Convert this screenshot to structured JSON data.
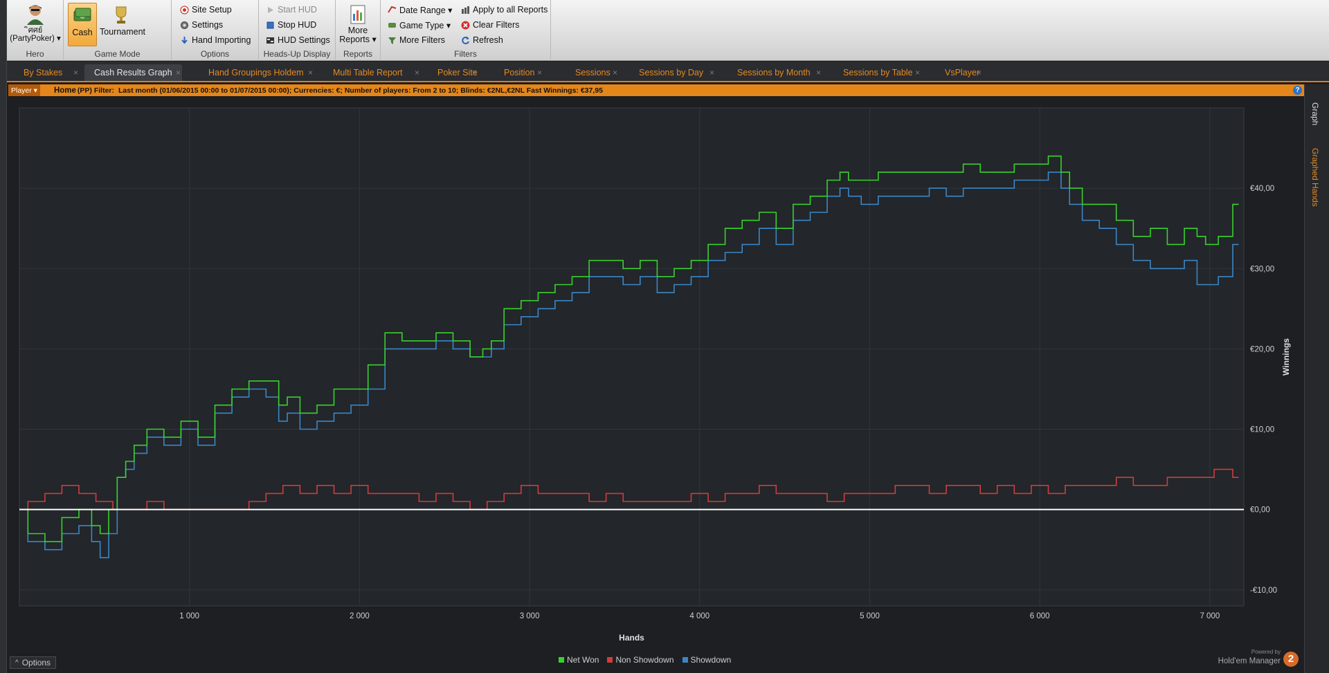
{
  "ribbon": {
    "hero": {
      "name_line1": "ิศศย์",
      "name_line2": "(PartyPoker) ▾",
      "group_label": "Hero"
    },
    "game_mode": {
      "cash_label": "Cash",
      "tournament_label": "Tournament",
      "group_label": "Game Mode"
    },
    "options": {
      "site_setup": "Site Setup",
      "settings": "Settings",
      "hand_importing": "Hand Importing",
      "group_label": "Options"
    },
    "hud": {
      "start_hud": "Start HUD",
      "stop_hud": "Stop HUD",
      "hud_settings": "HUD Settings",
      "group_label": "Heads-Up Display"
    },
    "reports": {
      "more_line1": "More",
      "more_line2": "Reports ▾",
      "group_label": "Reports"
    },
    "filters": {
      "date_range": "Date Range ▾",
      "game_type": "Game Type ▾",
      "more_filters": "More Filters",
      "apply_all": "Apply to all Reports",
      "clear_filters": "Clear Filters",
      "refresh": "Refresh",
      "group_label": "Filters"
    }
  },
  "tabs": [
    {
      "label": "By Stakes"
    },
    {
      "label": "Cash Results Graph"
    },
    {
      "label": "Hand Groupings Holdem"
    },
    {
      "label": "Multi Table Report"
    },
    {
      "label": "Poker Site"
    },
    {
      "label": "Position"
    },
    {
      "label": "Sessions"
    },
    {
      "label": "Sessions by Day"
    },
    {
      "label": "Sessions by Month"
    },
    {
      "label": "Sessions by Table"
    },
    {
      "label": "VsPlayer"
    }
  ],
  "tab_close": "×",
  "filterbar": {
    "player": "Player ▾",
    "home": "Home",
    "prefix": "(PP)  Filter:",
    "text": "Last month (01/06/2015 00:00 to 01/07/2015 00:00); Currencies: €; Number of players: From 2 to 10; Blinds: €2NL,€2NL Fast  Winnings: €37,95",
    "help": "?"
  },
  "sidepanel": {
    "graph": "Graph",
    "graphed_hands": "Graphed Hands"
  },
  "chart_data": {
    "type": "line",
    "xlabel": "Hands",
    "ylabel": "Winnings",
    "xlim": [
      0,
      7200
    ],
    "ylim": [
      -12,
      50
    ],
    "x_ticks": [
      1000,
      2000,
      3000,
      4000,
      5000,
      6000,
      7000
    ],
    "x_tick_labels": [
      "1 000",
      "2 000",
      "3 000",
      "4 000",
      "5 000",
      "6 000",
      "7 000"
    ],
    "y_ticks": [
      -10,
      0,
      10,
      20,
      30,
      40
    ],
    "y_tick_labels": [
      "-€10,00",
      "€0,00",
      "€10,00",
      "€20,00",
      "€30,00",
      "€40,00"
    ],
    "grid": true,
    "legend_position": "bottom",
    "series": [
      {
        "name": "Net Won",
        "color": "#39d22d",
        "x": [
          0,
          100,
          200,
          300,
          400,
          450,
          500,
          550,
          600,
          650,
          700,
          800,
          900,
          1000,
          1100,
          1200,
          1300,
          1400,
          1500,
          1550,
          1600,
          1700,
          1800,
          1900,
          2000,
          2100,
          2200,
          2300,
          2400,
          2500,
          2600,
          2700,
          2750,
          2800,
          2900,
          3000,
          3100,
          3200,
          3300,
          3400,
          3500,
          3600,
          3700,
          3800,
          3900,
          4000,
          4100,
          4200,
          4300,
          4400,
          4500,
          4600,
          4700,
          4800,
          4850,
          4900,
          5000,
          5100,
          5200,
          5300,
          5400,
          5500,
          5600,
          5700,
          5800,
          5900,
          6000,
          6100,
          6150,
          6200,
          6300,
          6400,
          6500,
          6600,
          6700,
          6800,
          6900,
          6950,
          7000,
          7100,
          7170
        ],
        "y": [
          0,
          -3,
          -4,
          -1,
          0,
          -2,
          -3,
          0,
          4,
          6,
          8,
          10,
          9,
          11,
          9,
          13,
          15,
          16,
          16,
          13,
          14,
          12,
          13,
          15,
          15,
          18,
          22,
          21,
          21,
          22,
          21,
          19,
          20,
          21,
          25,
          26,
          27,
          28,
          29,
          31,
          31,
          30,
          31,
          29,
          30,
          31,
          33,
          35,
          36,
          37,
          35,
          38,
          39,
          41,
          42,
          41,
          41,
          42,
          42,
          42,
          42,
          42,
          43,
          42,
          42,
          43,
          43,
          44,
          42,
          40,
          38,
          38,
          36,
          34,
          35,
          33,
          35,
          34,
          33,
          34,
          38
        ]
      },
      {
        "name": "Non Showdown",
        "color": "#d23c3c",
        "x": [
          0,
          100,
          200,
          300,
          400,
          500,
          600,
          700,
          800,
          900,
          1000,
          1100,
          1200,
          1300,
          1400,
          1500,
          1600,
          1700,
          1800,
          1900,
          2000,
          2100,
          2200,
          2300,
          2400,
          2500,
          2600,
          2700,
          2800,
          2900,
          3000,
          3100,
          3200,
          3300,
          3400,
          3500,
          3600,
          3700,
          3800,
          3900,
          4000,
          4100,
          4200,
          4300,
          4400,
          4500,
          4600,
          4700,
          4800,
          4900,
          5000,
          5100,
          5200,
          5300,
          5400,
          5500,
          5600,
          5700,
          5800,
          5900,
          6000,
          6100,
          6200,
          6300,
          6400,
          6500,
          6600,
          6700,
          6800,
          6900,
          7000,
          7050,
          7100,
          7170
        ],
        "y": [
          0,
          1,
          2,
          3,
          2,
          1,
          0,
          0,
          1,
          0,
          0,
          0,
          0,
          0,
          1,
          2,
          3,
          2,
          3,
          2,
          3,
          2,
          2,
          2,
          1,
          2,
          1,
          0,
          1,
          2,
          3,
          2,
          2,
          2,
          1,
          2,
          1,
          1,
          1,
          1,
          2,
          1,
          2,
          2,
          3,
          2,
          2,
          2,
          1,
          2,
          2,
          2,
          3,
          3,
          2,
          3,
          3,
          2,
          3,
          2,
          3,
          2,
          3,
          3,
          3,
          4,
          3,
          3,
          4,
          4,
          4,
          5,
          5,
          4
        ]
      },
      {
        "name": "Showdown",
        "color": "#3a87c8",
        "x": [
          0,
          100,
          200,
          300,
          400,
          450,
          500,
          550,
          600,
          650,
          700,
          800,
          900,
          1000,
          1100,
          1200,
          1300,
          1400,
          1500,
          1550,
          1600,
          1700,
          1800,
          1900,
          2000,
          2100,
          2200,
          2300,
          2400,
          2500,
          2600,
          2700,
          2750,
          2800,
          2900,
          3000,
          3100,
          3200,
          3300,
          3400,
          3500,
          3600,
          3700,
          3800,
          3900,
          4000,
          4100,
          4200,
          4300,
          4400,
          4500,
          4600,
          4700,
          4800,
          4850,
          4900,
          5000,
          5100,
          5200,
          5300,
          5400,
          5500,
          5600,
          5700,
          5800,
          5900,
          6000,
          6100,
          6150,
          6200,
          6300,
          6400,
          6500,
          6600,
          6700,
          6800,
          6900,
          6950,
          7000,
          7100,
          7170
        ],
        "y": [
          0,
          -4,
          -5,
          -3,
          -2,
          -4,
          -6,
          -3,
          4,
          5,
          7,
          9,
          8,
          10,
          8,
          12,
          14,
          15,
          14,
          11,
          12,
          10,
          11,
          12,
          13,
          15,
          20,
          20,
          20,
          21,
          20,
          19,
          19,
          20,
          23,
          24,
          25,
          26,
          27,
          29,
          29,
          28,
          29,
          27,
          28,
          29,
          31,
          32,
          33,
          35,
          33,
          36,
          37,
          39,
          40,
          39,
          38,
          39,
          39,
          39,
          40,
          39,
          40,
          40,
          40,
          41,
          41,
          42,
          40,
          38,
          36,
          35,
          33,
          31,
          30,
          30,
          31,
          28,
          28,
          29,
          33
        ]
      },
      {
        "name": "",
        "color": "#ffffff",
        "x": [
          0,
          7200
        ],
        "y": [
          0,
          0
        ]
      }
    ]
  },
  "bottom": {
    "options": "Options",
    "options_arrow": "^",
    "powered_by": "Powered by",
    "brand": "Hold'em Manager",
    "logo_text": "2"
  }
}
